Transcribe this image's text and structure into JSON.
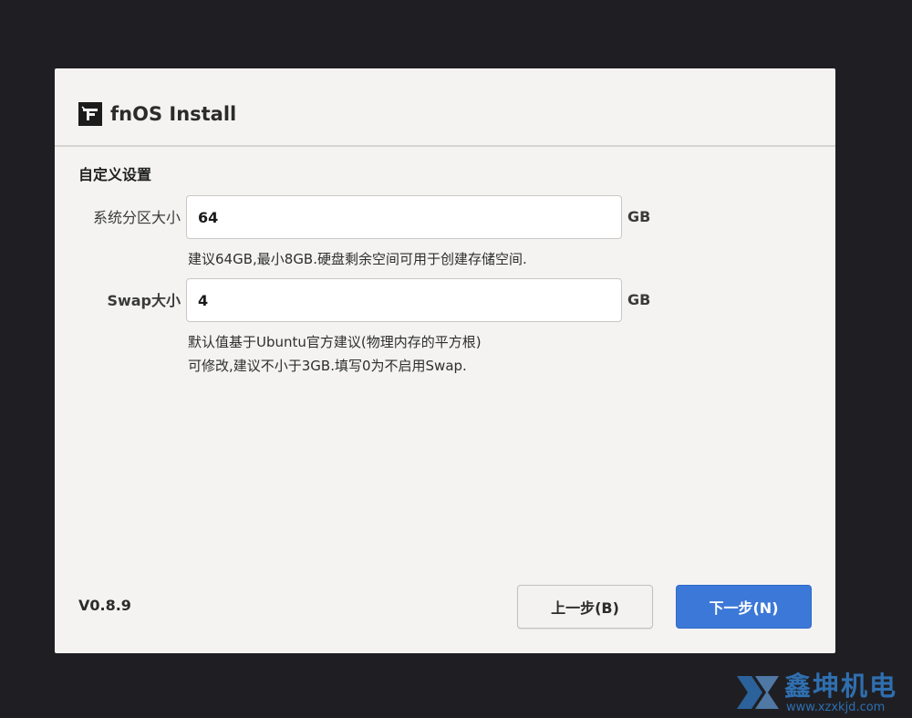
{
  "window": {
    "app_title": "fnOS Install",
    "app_icon": "fnos-logo-icon"
  },
  "section": {
    "title": "自定义设置"
  },
  "system_partition": {
    "label": "系统分区大小",
    "value": "64",
    "unit": "GB",
    "hint": "建议64GB,最小8GB.硬盘剩余空间可用于创建存储空间."
  },
  "swap": {
    "label": "Swap大小",
    "value": "4",
    "unit": "GB",
    "hint_line1": "默认值基于Ubuntu官方建议(物理内存的平方根)",
    "hint_line2": "可修改,建议不小于3GB.填写0为不启用Swap."
  },
  "footer": {
    "version": "V0.8.9",
    "prev_label": "上一步(B)",
    "next_label": "下一步(N)"
  },
  "watermark": {
    "title": "鑫坤机电",
    "url": "www.xzxkjd.com"
  },
  "colors": {
    "background": "#1f1f23",
    "window": "#f4f3f2",
    "accent": "#3c78d8",
    "watermark": "#2f6fb0"
  }
}
